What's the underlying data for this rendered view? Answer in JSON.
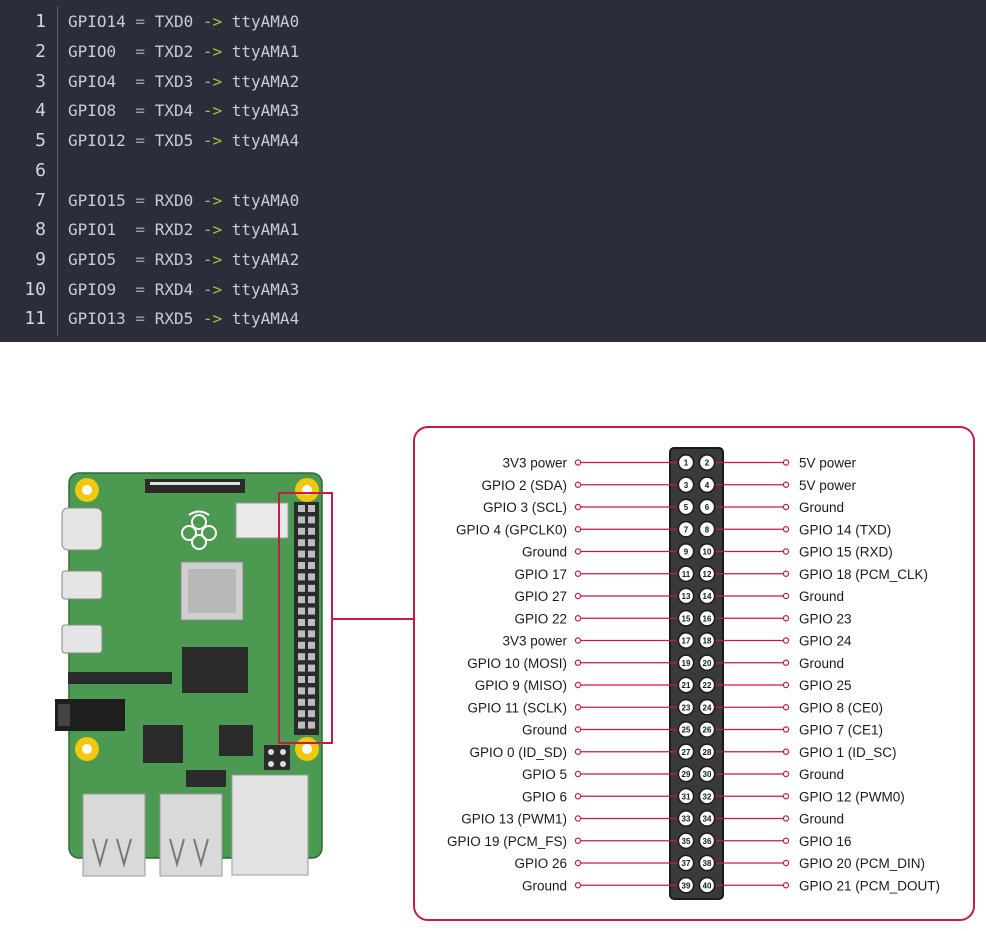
{
  "code": {
    "lines": [
      {
        "n": "1",
        "gpio": "GPIO14",
        "eq": " = ",
        "sig": "TXD0",
        "arrow": " -> ",
        "tty": "ttyAMA0"
      },
      {
        "n": "2",
        "gpio": "GPIO0 ",
        "eq": " = ",
        "sig": "TXD2",
        "arrow": " -> ",
        "tty": "ttyAMA1"
      },
      {
        "n": "3",
        "gpio": "GPIO4 ",
        "eq": " = ",
        "sig": "TXD3",
        "arrow": " -> ",
        "tty": "ttyAMA2"
      },
      {
        "n": "4",
        "gpio": "GPIO8 ",
        "eq": " = ",
        "sig": "TXD4",
        "arrow": " -> ",
        "tty": "ttyAMA3"
      },
      {
        "n": "5",
        "gpio": "GPIO12",
        "eq": " = ",
        "sig": "TXD5",
        "arrow": " -> ",
        "tty": "ttyAMA4"
      },
      {
        "n": "6",
        "gpio": "",
        "eq": "",
        "sig": "",
        "arrow": "",
        "tty": ""
      },
      {
        "n": "7",
        "gpio": "GPIO15",
        "eq": " = ",
        "sig": "RXD0",
        "arrow": " -> ",
        "tty": "ttyAMA0"
      },
      {
        "n": "8",
        "gpio": "GPIO1 ",
        "eq": " = ",
        "sig": "RXD2",
        "arrow": " -> ",
        "tty": "ttyAMA1"
      },
      {
        "n": "9",
        "gpio": "GPIO5 ",
        "eq": " = ",
        "sig": "RXD3",
        "arrow": " -> ",
        "tty": "ttyAMA2"
      },
      {
        "n": "10",
        "gpio": "GPIO9 ",
        "eq": " = ",
        "sig": "RXD4",
        "arrow": " -> ",
        "tty": "ttyAMA3"
      },
      {
        "n": "11",
        "gpio": "GPIO13",
        "eq": " = ",
        "sig": "RXD5",
        "arrow": " -> ",
        "tty": "ttyAMA4"
      }
    ]
  },
  "pinout": {
    "left": [
      "3V3 power",
      "GPIO 2 (SDA)",
      "GPIO 3 (SCL)",
      "GPIO 4 (GPCLK0)",
      "Ground",
      "GPIO 17",
      "GPIO 27",
      "GPIO 22",
      "3V3 power",
      "GPIO 10 (MOSI)",
      "GPIO 9 (MISO)",
      "GPIO 11 (SCLK)",
      "Ground",
      "GPIO 0 (ID_SD)",
      "GPIO 5",
      "GPIO 6",
      "GPIO 13 (PWM1)",
      "GPIO 19 (PCM_FS)",
      "GPIO 26",
      "Ground"
    ],
    "right": [
      "5V power",
      "5V power",
      "Ground",
      "GPIO 14 (TXD)",
      "GPIO 15 (RXD)",
      "GPIO 18 (PCM_CLK)",
      "Ground",
      "GPIO 23",
      "GPIO 24",
      "Ground",
      "GPIO 25",
      "GPIO 8 (CE0)",
      "GPIO 7 (CE1)",
      "GPIO 1 (ID_SC)",
      "Ground",
      "GPIO 12 (PWM0)",
      "Ground",
      "GPIO 16",
      "GPIO 20 (PCM_DIN)",
      "GPIO 21 (PCM_DOUT)"
    ],
    "pin_numbers_left": [
      "1",
      "3",
      "5",
      "7",
      "9",
      "11",
      "13",
      "15",
      "17",
      "19",
      "21",
      "23",
      "25",
      "27",
      "29",
      "31",
      "33",
      "35",
      "37",
      "39"
    ],
    "pin_numbers_right": [
      "2",
      "4",
      "6",
      "8",
      "10",
      "12",
      "14",
      "16",
      "18",
      "20",
      "22",
      "24",
      "26",
      "28",
      "30",
      "32",
      "34",
      "36",
      "38",
      "40"
    ]
  },
  "colors": {
    "code_bg": "#2b2d3b",
    "code_text": "#c9ccd8",
    "arrow": "#9bc742",
    "callout": "#c31c4a",
    "board_green": "#4c9a52",
    "mount_hole": "#f2c80f",
    "header_bg": "#3a3a3a"
  }
}
